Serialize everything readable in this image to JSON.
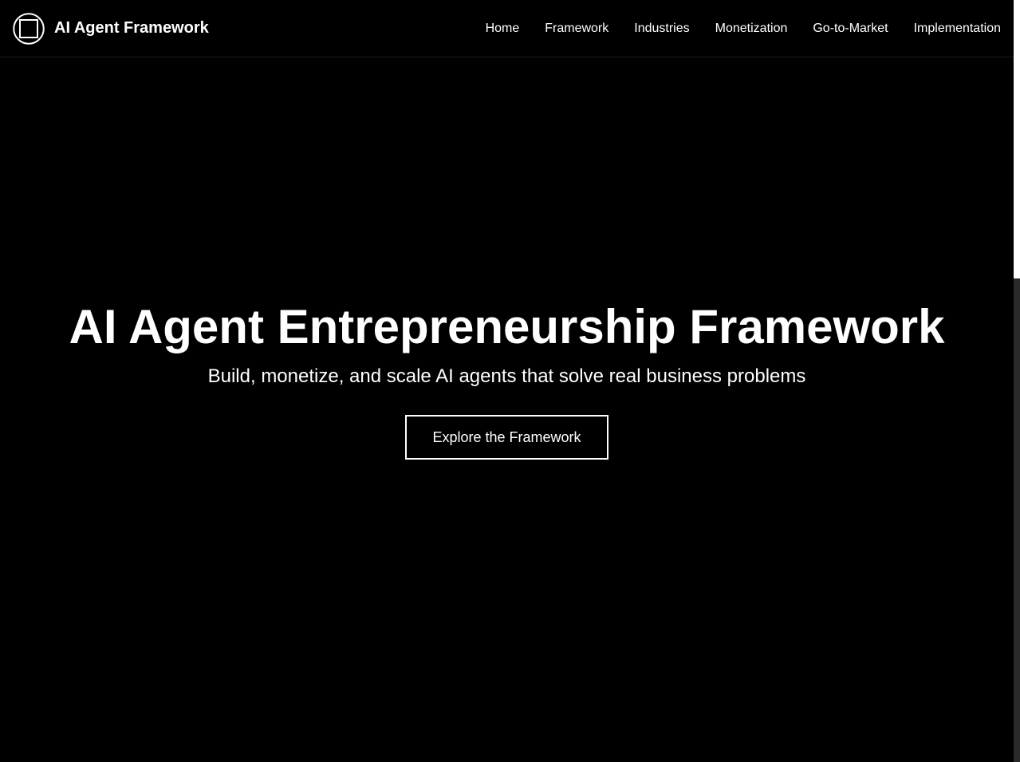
{
  "header": {
    "brand_name": "AI Agent Framework",
    "logo_icon": "square-in-circle-icon",
    "nav": [
      {
        "label": "Home"
      },
      {
        "label": "Framework"
      },
      {
        "label": "Industries"
      },
      {
        "label": "Monetization"
      },
      {
        "label": "Go-to-Market"
      },
      {
        "label": "Implementation"
      }
    ]
  },
  "hero": {
    "title": "AI Agent Entrepreneurship Framework",
    "subtitle": "Build, monetize, and scale AI agents that solve real business problems",
    "cta_label": "Explore the Framework"
  },
  "colors": {
    "background": "#000000",
    "text": "#ffffff",
    "accent_border": "#ffffff"
  }
}
